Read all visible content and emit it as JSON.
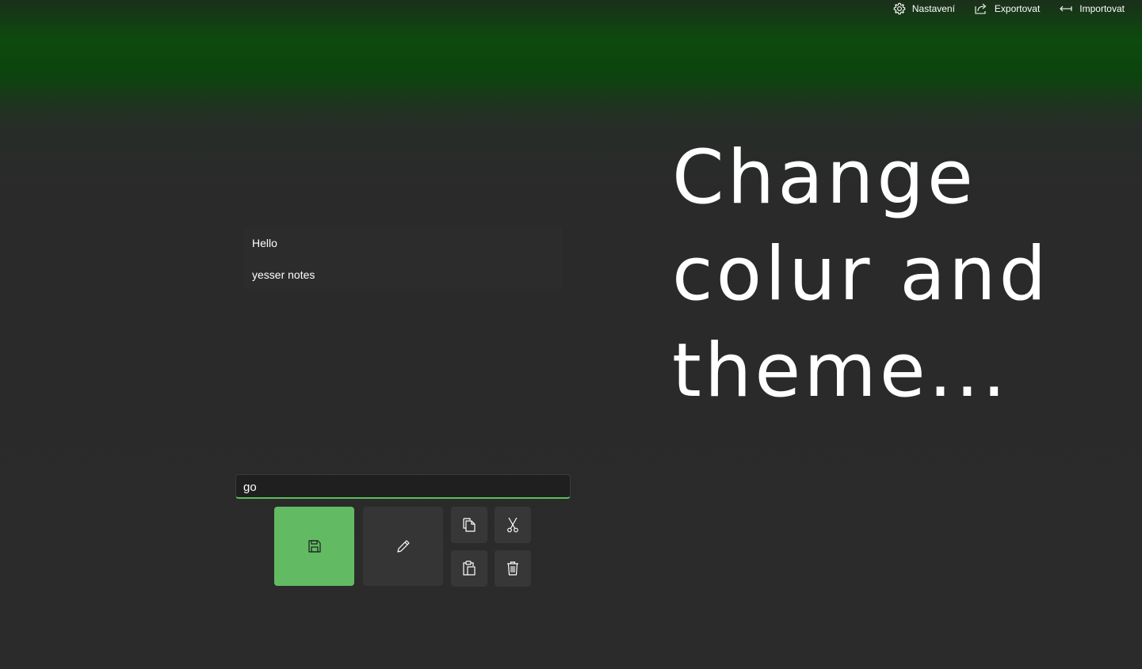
{
  "topbar": {
    "settings": {
      "label": "Nastavení",
      "icon": "gear-icon"
    },
    "export": {
      "label": "Exportovat",
      "icon": "share-icon"
    },
    "import": {
      "label": "Importovat",
      "icon": "arrow-left-icon"
    }
  },
  "notes": [
    {
      "title": "Hello"
    },
    {
      "title": "yesser notes"
    }
  ],
  "headline": {
    "line1": "Change",
    "line2": "colur and",
    "line3": "theme..."
  },
  "editor": {
    "value": "go"
  },
  "actions": {
    "save_icon": "save-icon",
    "edit_icon": "pencil-icon",
    "copy_icon": "copy-icon",
    "cut_icon": "scissors-icon",
    "paste_icon": "paste-icon",
    "delete_icon": "trash-icon"
  },
  "colors": {
    "accent": "#62bb63",
    "header_gradient": "#0d4a0d",
    "background": "#2b2b2b"
  }
}
